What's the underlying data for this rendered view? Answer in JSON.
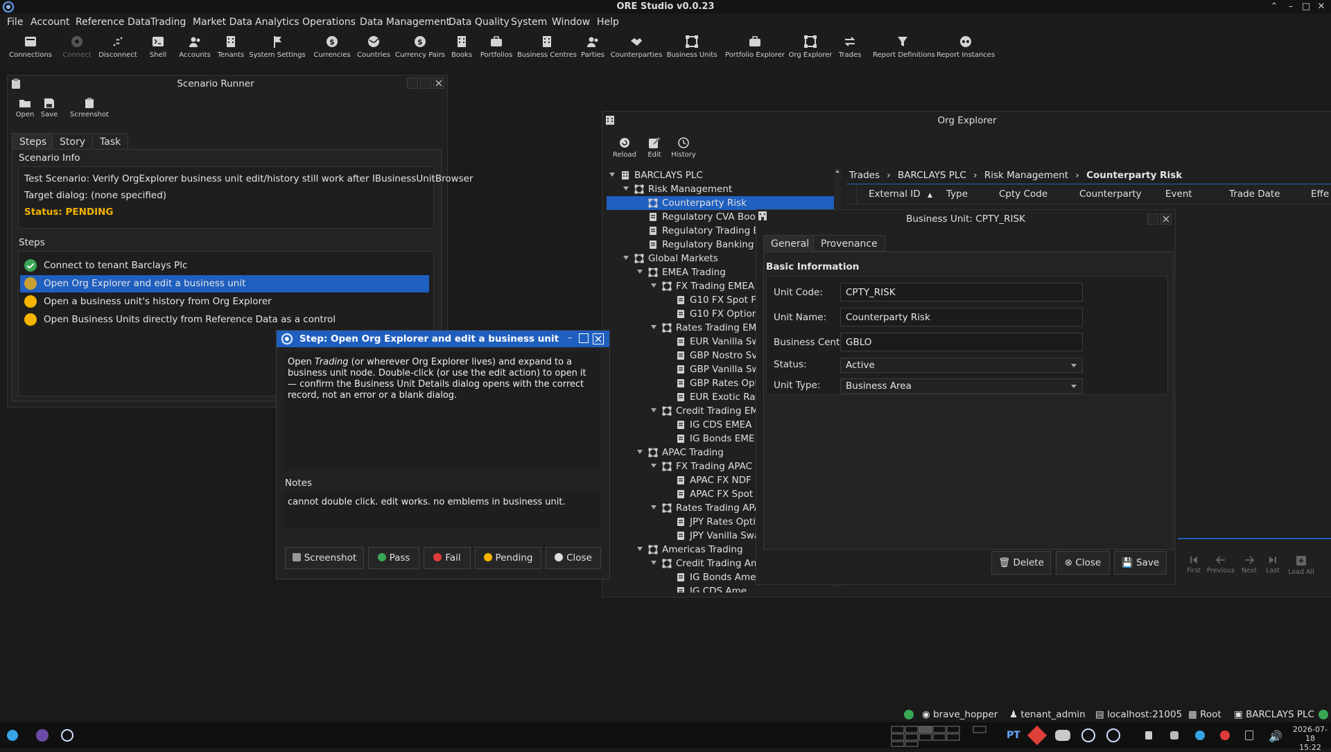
{
  "app": {
    "title": "ORE Studio v0.0.23"
  },
  "menu": [
    "File",
    "Account",
    "Reference Data",
    "Trading",
    "Market Data",
    "Analytics",
    "Operations",
    "Data Management",
    "Data Quality",
    "System",
    "Window",
    "Help"
  ],
  "toolbar": [
    {
      "label": "Connections",
      "icon": "connections-icon"
    },
    {
      "label": "Connect",
      "icon": "connect-icon",
      "disabled": true
    },
    {
      "label": "Disconnect",
      "icon": "disconnect-icon"
    },
    {
      "label": "Shell",
      "icon": "shell-icon"
    },
    {
      "label": "Accounts",
      "icon": "accounts-icon"
    },
    {
      "label": "Tenants",
      "icon": "tenants-icon"
    },
    {
      "label": "System Settings",
      "icon": "flag-icon"
    },
    {
      "label": "Currencies",
      "icon": "currency-icon"
    },
    {
      "label": "Countries",
      "icon": "globe-icon"
    },
    {
      "label": "Currency Pairs",
      "icon": "currency-pairs-icon"
    },
    {
      "label": "Books",
      "icon": "book-icon"
    },
    {
      "label": "Portfolios",
      "icon": "portfolio-icon"
    },
    {
      "label": "Business Centres",
      "icon": "building-icon"
    },
    {
      "label": "Parties",
      "icon": "parties-icon"
    },
    {
      "label": "Counterparties",
      "icon": "handshake-icon"
    },
    {
      "label": "Business Units",
      "icon": "business-unit-icon"
    },
    {
      "label": "Portfolio Explorer",
      "icon": "portfolio-explorer-icon"
    },
    {
      "label": "Org Explorer",
      "icon": "org-explorer-icon"
    },
    {
      "label": "Trades",
      "icon": "trades-icon"
    },
    {
      "label": "Report Definitions",
      "icon": "report-definitions-icon"
    },
    {
      "label": "Report Instances",
      "icon": "report-instances-icon"
    }
  ],
  "scenario_runner": {
    "title": "Scenario Runner",
    "tools": [
      "Open",
      "Save",
      "Screenshot"
    ],
    "tabs": [
      "Steps",
      "Story",
      "Task"
    ],
    "info_heading": "Scenario Info",
    "test_scenario": "Test Scenario: Verify OrgExplorer business unit edit/history still work after IBusinessUnitBrowser",
    "target_dialog": "Target dialog: (none specified)",
    "status": "Status: PENDING",
    "steps_heading": "Steps",
    "steps": [
      {
        "label": "Connect to tenant Barclays Plc",
        "state": "pass"
      },
      {
        "label": "Open Org Explorer and edit a business unit",
        "state": "selected"
      },
      {
        "label": "Open a business unit's history from Org Explorer",
        "state": "pending"
      },
      {
        "label": "Open Business Units directly from Reference Data as a control",
        "state": "pending"
      }
    ]
  },
  "step_dialog": {
    "title": "Step: Open Org Explorer and edit a business unit",
    "desc_pre": "Open ",
    "desc_italic": "Trading",
    "desc_post": " (or wherever Org Explorer lives) and expand to a business unit node. Double-click (or use the edit action) to open it — confirm the Business Unit Details dialog opens with the correct record, not an error or a blank dialog.",
    "notes_label": "Notes",
    "notes": "cannot double click. edit works. no emblems in business unit.",
    "buttons": [
      "Screenshot",
      "Pass",
      "Fail",
      "Pending",
      "Close"
    ]
  },
  "org_explorer": {
    "title": "Org Explorer",
    "tools": [
      "Reload",
      "Edit",
      "History"
    ],
    "breadcrumb": [
      "Trades",
      "BARCLAYS PLC",
      "Risk Management",
      "Counterparty Risk"
    ],
    "columns": [
      "External ID",
      "Type",
      "Cpty Code",
      "Counterparty",
      "Event",
      "Trade Date",
      "Effe"
    ],
    "tree": [
      {
        "label": "BARCLAYS PLC",
        "depth": 0,
        "kind": "org",
        "expanded": true
      },
      {
        "label": "Risk Management",
        "depth": 1,
        "kind": "unit",
        "expanded": true
      },
      {
        "label": "Counterparty Risk",
        "depth": 2,
        "kind": "unit",
        "selected": true
      },
      {
        "label": "Regulatory CVA Book",
        "depth": 2,
        "kind": "book"
      },
      {
        "label": "Regulatory Trading B",
        "depth": 2,
        "kind": "book"
      },
      {
        "label": "Regulatory Banking E",
        "depth": 2,
        "kind": "book"
      },
      {
        "label": "Global Markets",
        "depth": 1,
        "kind": "unit",
        "expanded": true
      },
      {
        "label": "EMEA Trading",
        "depth": 2,
        "kind": "unit",
        "expanded": true
      },
      {
        "label": "FX Trading EMEA",
        "depth": 3,
        "kind": "unit",
        "expanded": true
      },
      {
        "label": "G10 FX Spot Fo",
        "depth": 4,
        "kind": "book"
      },
      {
        "label": "G10 FX Option",
        "depth": 4,
        "kind": "book"
      },
      {
        "label": "Rates Trading EMI",
        "depth": 3,
        "kind": "unit",
        "expanded": true
      },
      {
        "label": "EUR Vanilla Sw",
        "depth": 4,
        "kind": "book"
      },
      {
        "label": "GBP Nostro Sv",
        "depth": 4,
        "kind": "book"
      },
      {
        "label": "GBP Vanilla Sw",
        "depth": 4,
        "kind": "book"
      },
      {
        "label": "GBP Rates Opt",
        "depth": 4,
        "kind": "book"
      },
      {
        "label": "EUR Exotic Rat",
        "depth": 4,
        "kind": "book"
      },
      {
        "label": "Credit Trading EM",
        "depth": 3,
        "kind": "unit",
        "expanded": true
      },
      {
        "label": "IG CDS EMEA",
        "depth": 4,
        "kind": "book"
      },
      {
        "label": "IG Bonds EME",
        "depth": 4,
        "kind": "book"
      },
      {
        "label": "APAC Trading",
        "depth": 2,
        "kind": "unit",
        "expanded": true
      },
      {
        "label": "FX Trading APAC",
        "depth": 3,
        "kind": "unit",
        "expanded": true
      },
      {
        "label": "APAC FX NDF",
        "depth": 4,
        "kind": "book"
      },
      {
        "label": "APAC FX Spot F",
        "depth": 4,
        "kind": "book"
      },
      {
        "label": "Rates Trading APA",
        "depth": 3,
        "kind": "unit",
        "expanded": true
      },
      {
        "label": "JPY Rates Opti",
        "depth": 4,
        "kind": "book"
      },
      {
        "label": "JPY Vanilla Swa",
        "depth": 4,
        "kind": "book"
      },
      {
        "label": "Americas Trading",
        "depth": 2,
        "kind": "unit",
        "expanded": true
      },
      {
        "label": "Credit Trading Am",
        "depth": 3,
        "kind": "unit",
        "expanded": true
      },
      {
        "label": "IG Bonds Ame",
        "depth": 4,
        "kind": "book"
      },
      {
        "label": "IG CDS Ame",
        "depth": 4,
        "kind": "book"
      }
    ],
    "nav": [
      "First",
      "Previous",
      "Next",
      "Last",
      "Load All"
    ]
  },
  "business_unit": {
    "title": "Business Unit: CPTY_RISK",
    "tabs": [
      "General",
      "Provenance"
    ],
    "section": "Basic Information",
    "fields": {
      "unit_code": {
        "label": "Unit Code:",
        "value": "CPTY_RISK"
      },
      "unit_name": {
        "label": "Unit Name:",
        "value": "Counterparty Risk"
      },
      "business_centre": {
        "label": "Business Centre:",
        "value": "GBLO"
      },
      "status": {
        "label": "Status:",
        "value": "Active"
      },
      "unit_type": {
        "label": "Unit Type:",
        "value": "Business Area"
      }
    },
    "buttons": [
      "Delete",
      "Close",
      "Save"
    ]
  },
  "statusbar": {
    "user": "brave_hopper",
    "role": "tenant_admin",
    "server": "localhost:21005",
    "scope": "Root",
    "tenant": "BARCLAYS PLC"
  },
  "taskbar": {
    "date": "2026-07-18",
    "time": "15:22"
  },
  "colors": {
    "accent": "#1f5fbf",
    "pass": "#3aa757",
    "pending": "#f5b400",
    "fail": "#e03b3b",
    "status_pending": "#f5b400"
  }
}
